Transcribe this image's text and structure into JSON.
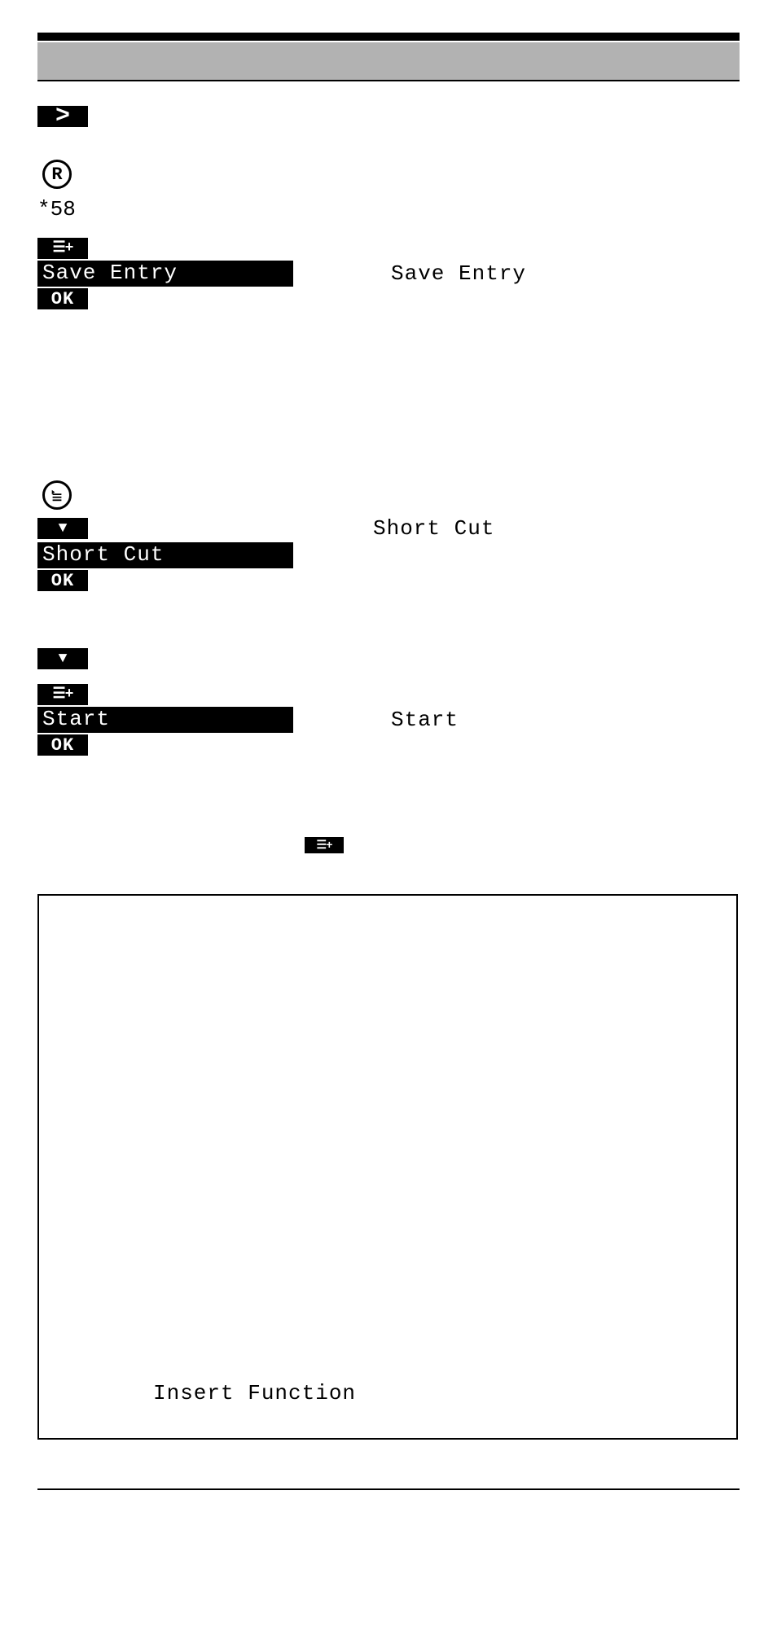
{
  "code": "*58",
  "block1": {
    "pill": "Save Entry",
    "side": "Save Entry",
    "ok": "OK"
  },
  "block2": {
    "pill": "Short Cut",
    "side": "Short Cut",
    "ok": "OK"
  },
  "block3": {
    "pill": "Start",
    "side": "Start",
    "ok": "OK"
  },
  "frame": {
    "text": "Insert Function"
  }
}
